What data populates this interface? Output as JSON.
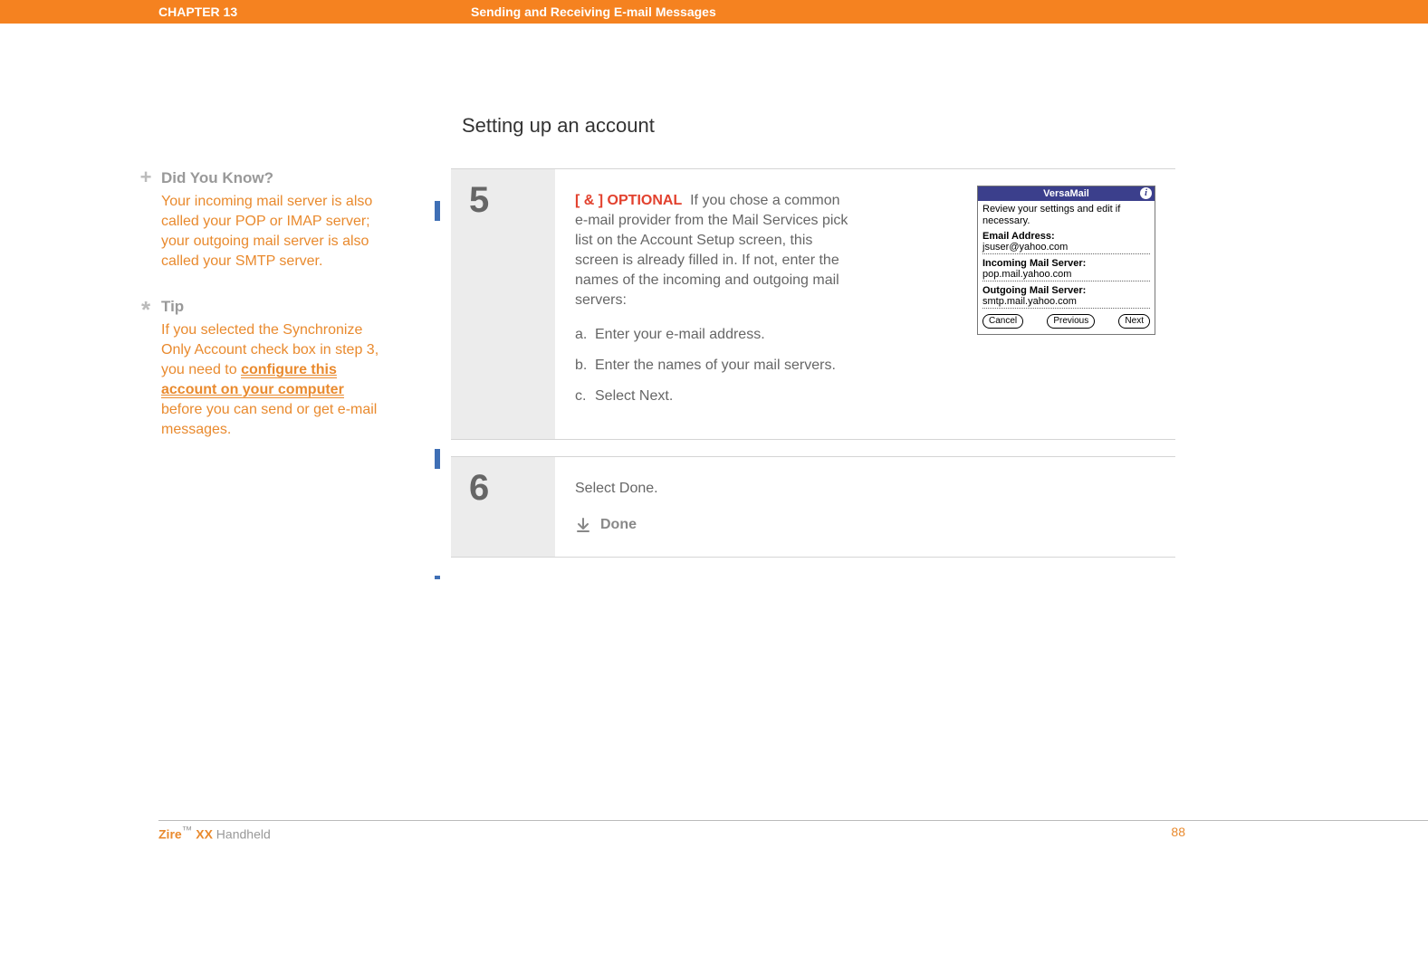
{
  "header": {
    "chapter": "CHAPTER 13",
    "title": "Sending and Receiving E-mail Messages"
  },
  "section_heading": "Setting up an account",
  "sidebar": {
    "didYouKnow": {
      "heading": "Did You Know?",
      "body": "Your incoming mail server is also called your POP or IMAP server; your outgoing mail server is also called your SMTP server."
    },
    "tip": {
      "heading": "Tip",
      "body_pre": "If you selected the Synchronize Only Account check box in step 3, you need to ",
      "link_text": "configure this account on your computer",
      "body_post": " before you can send or get e-mail messages."
    }
  },
  "steps": [
    {
      "number": "5",
      "optional_tag": "[ & ]  OPTIONAL",
      "intro": "If you chose a common e-mail provider from the Mail Services pick list on the Account Setup screen, this screen is already filled in. If not, enter the names of the incoming and outgoing mail servers:",
      "subitems": [
        {
          "label": "a.",
          "text": "Enter your e-mail address."
        },
        {
          "label": "b.",
          "text": "Enter the names of your mail servers."
        },
        {
          "label": "c.",
          "text": "Select Next."
        }
      ],
      "palm": {
        "title": "VersaMail",
        "instruction": "Review your settings and edit if necessary.",
        "fields": [
          {
            "label": "Email Address:",
            "value": "jsuser@yahoo.com"
          },
          {
            "label": "Incoming Mail Server:",
            "value": "pop.mail.yahoo.com"
          },
          {
            "label": "Outgoing Mail Server:",
            "value": "smtp.mail.yahoo.com"
          }
        ],
        "buttons": [
          "Cancel",
          "Previous",
          "Next"
        ]
      }
    },
    {
      "number": "6",
      "text": "Select Done.",
      "done_label": "Done"
    }
  ],
  "footer": {
    "brand": "Zire",
    "tm": "™",
    "model": "XX",
    "product_suffix": " Handheld",
    "page": "88"
  }
}
